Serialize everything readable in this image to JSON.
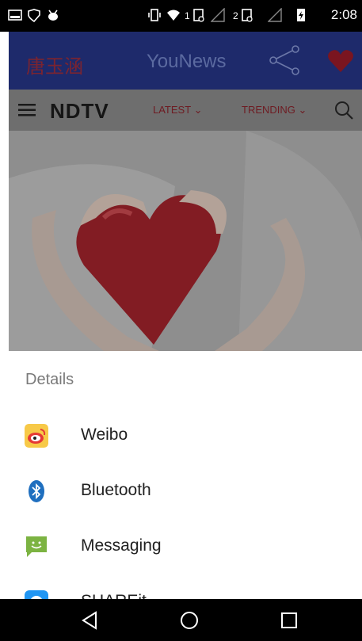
{
  "status_bar": {
    "sim1": "1",
    "sim2": "2",
    "time": "2:08"
  },
  "app_header": {
    "chinese_title": "唐玉涵",
    "brand": "YouNews",
    "share_icon": "share-icon",
    "heart_icon": "heart-icon"
  },
  "site_nav": {
    "logo": "NDTV",
    "latest": "LATEST",
    "trending": "TRENDING",
    "menu_icon": "hamburger-icon",
    "search_icon": "search-icon"
  },
  "share_sheet": {
    "title": "Details",
    "items": [
      {
        "label": "Weibo",
        "icon": "weibo-icon",
        "color": "#f7c948"
      },
      {
        "label": "Bluetooth",
        "icon": "bluetooth-icon",
        "color": "#1f6fbf"
      },
      {
        "label": "Messaging",
        "icon": "messaging-icon",
        "color": "#7cb342"
      },
      {
        "label": "SHAREit",
        "icon": "shareit-icon",
        "color": "#2196f3"
      }
    ]
  },
  "nav_bar": {
    "back": "back-icon",
    "home": "home-icon",
    "recents": "recents-icon"
  }
}
